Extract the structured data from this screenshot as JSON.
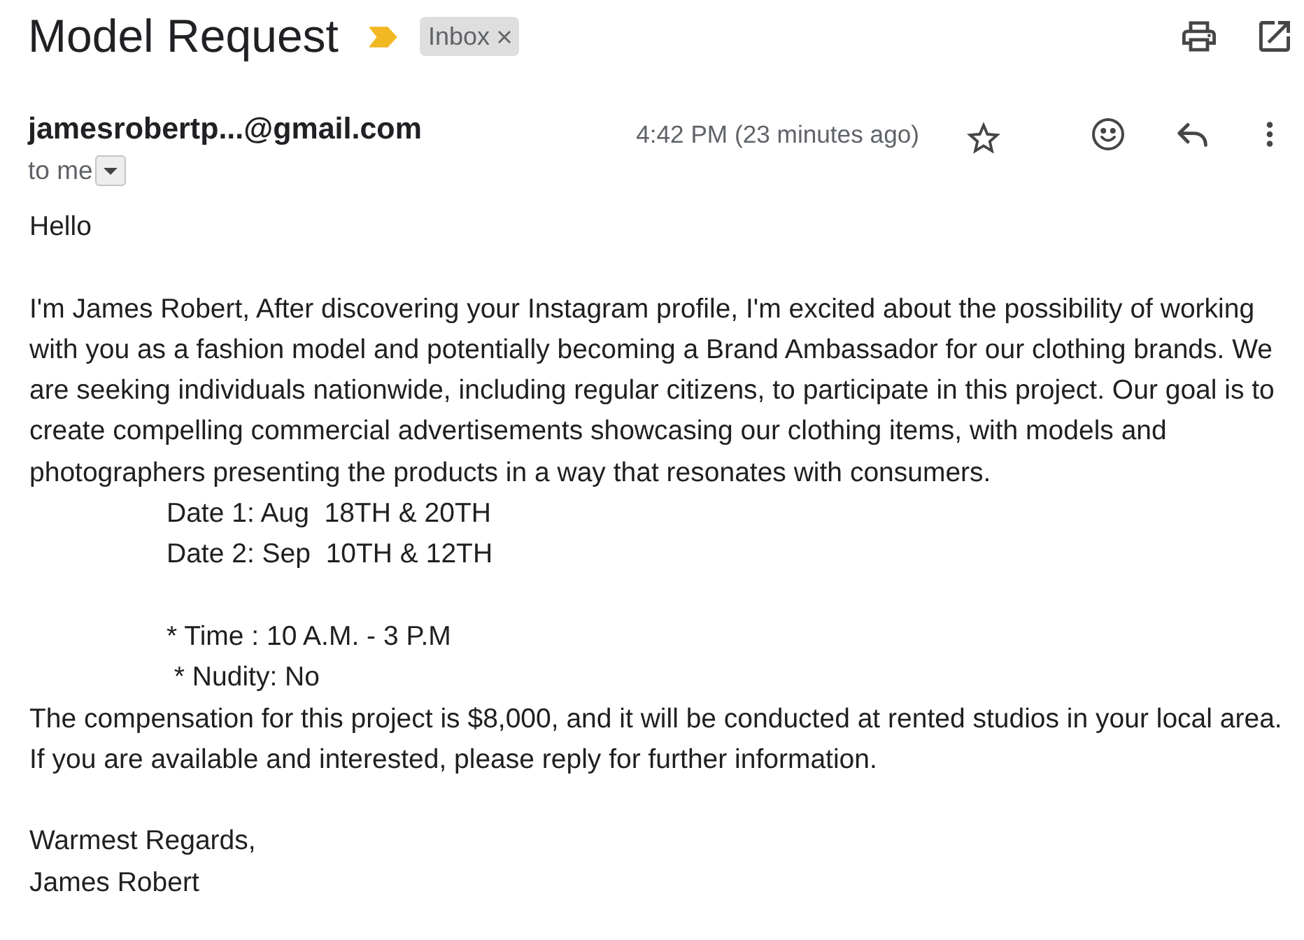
{
  "email": {
    "subject": "Model Request",
    "important": true,
    "labels": [
      {
        "name": "Inbox"
      }
    ]
  },
  "message": {
    "sender": "jamesrobertp...@gmail.com",
    "recipient": "to me",
    "time": "4:42 PM (23 minutes ago)",
    "starred": false
  },
  "body": [
    {
      "lines": [
        {
          "kind": "text",
          "text": "Hello"
        }
      ]
    },
    {
      "lines": [
        {
          "kind": "text",
          "text": "I'm James Robert, After discovering your Instagram profile, I'm excited about the possibility of working with you as a fashion model and potentially becoming a Brand Ambassador for our clothing brands. We are seeking individuals nationwide, including regular citizens, to participate in this project. Our goal is to create compelling commercial advertisements showcasing our clothing items, with models and photographers presenting the products in a way that resonates with consumers."
        },
        {
          "kind": "indented",
          "text": "Date 1: Aug  18TH & 20TH"
        },
        {
          "kind": "indented",
          "text": "Date 2: Sep  10TH & 12TH"
        }
      ]
    },
    {
      "lines": [
        {
          "kind": "indented",
          "text": "* Time : 10 A.M. - 3 P.M"
        },
        {
          "kind": "indented",
          "text": " * Nudity: No"
        },
        {
          "kind": "text",
          "text": "The compensation for this project is $8,000, and it will be conducted at rented studios in your local area."
        },
        {
          "kind": "text",
          "text": "If you are available and interested, please reply for further information."
        }
      ]
    },
    {
      "lines": [
        {
          "kind": "text",
          "text": "Warmest Regards,"
        },
        {
          "kind": "text",
          "text": "James Robert"
        }
      ]
    }
  ]
}
